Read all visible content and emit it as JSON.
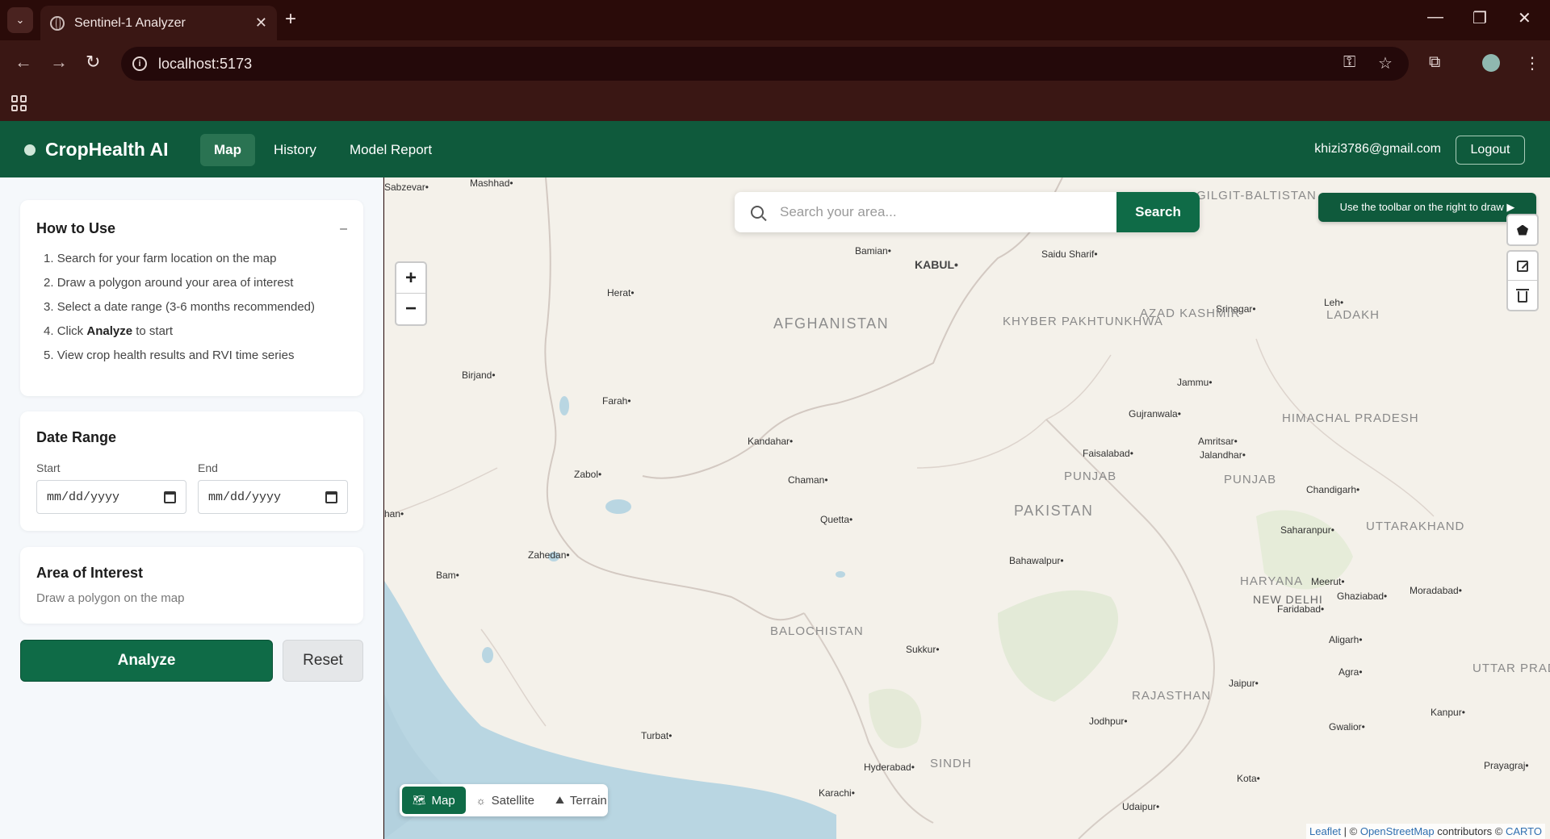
{
  "browser": {
    "tab_title": "Sentinel-1 Analyzer",
    "tab_close": "✕",
    "new_tab": "+",
    "url": "localhost:5173",
    "window_controls": [
      "—",
      "❐",
      "✕"
    ]
  },
  "header": {
    "brand": "CropHealth AI",
    "nav": [
      {
        "label": "Map",
        "active": true
      },
      {
        "label": "History",
        "active": false
      },
      {
        "label": "Model Report",
        "active": false
      }
    ],
    "user_email": "khizi3786@gmail.com",
    "logout_label": "Logout"
  },
  "sidebar": {
    "howto": {
      "title": "How to Use",
      "collapse": "–",
      "steps": [
        {
          "n": "1.",
          "text": "Search for your farm location on the map"
        },
        {
          "n": "2.",
          "text": "Draw a polygon around your area of interest"
        },
        {
          "n": "3.",
          "text": "Select a date range (3-6 months recommended)"
        },
        {
          "n": "4.",
          "pre": "Click ",
          "bold": "Analyze",
          "post": " to start"
        },
        {
          "n": "5.",
          "text": "View crop health results and RVI time series"
        }
      ]
    },
    "date_range": {
      "title": "Date Range",
      "start_label": "Start",
      "end_label": "End",
      "start_value": "mm/dd/yyyy",
      "end_value": "mm/dd/yyyy"
    },
    "aoi": {
      "title": "Area of Interest",
      "hint": "Draw a polygon on the map"
    },
    "analyze_label": "Analyze",
    "reset_label": "Reset"
  },
  "map": {
    "search_placeholder": "Search your area...",
    "search_button": "Search",
    "draw_hint": "Use the toolbar on the right to draw ▶",
    "zoom_in": "+",
    "zoom_out": "−",
    "layers": [
      {
        "label": "Map",
        "icon": "🗺",
        "active": true
      },
      {
        "label": "Satellite",
        "icon": "☼",
        "active": false
      },
      {
        "label": "Terrain",
        "icon": "⛰",
        "active": false
      }
    ],
    "attribution": {
      "leaflet": "Leaflet",
      "sep": " | © ",
      "osm": "OpenStreetMap",
      "rest": " contributors © ",
      "carto": "CARTO"
    },
    "places": [
      "Sabzevar",
      "Mashhad",
      "Bamian",
      "KABUL",
      "Saidu Sharif",
      "Herat",
      "Srinagar",
      "Leh",
      "Birjand",
      "Farah",
      "Jammu",
      "Gujranwala",
      "Kandahar",
      "Amritsar",
      "Faisalabad",
      "Jalandhar",
      "Zabol",
      "Chaman",
      "Chandigarh",
      "Quetta",
      "Saharanpur",
      "Zahedan",
      "Bahawalpur",
      "Bam",
      "Meerut",
      "Ghaziabad",
      "Moradabad",
      "Faridabad",
      "Aligarh",
      "Sukkur",
      "Agra",
      "Jaipur",
      "Kanpur",
      "Jodhpur",
      "Gwalior",
      "Turbat",
      "Hyderabad",
      "Karachi",
      "Kota",
      "Prayagraj",
      "Udaipur",
      "han"
    ],
    "regions": [
      "AFGHANISTAN",
      "KHYBER PAKHTUNKHWA",
      "AZAD KASHMIR",
      "LADAKH",
      "GILGIT-BALTISTAN",
      "HIMACHAL PRADESH",
      "PUNJAB",
      "PUNJAB",
      "PAKISTAN",
      "UTTARAKHAND",
      "HARYANA",
      "NEW DELHI",
      "BALOCHISTAN",
      "RAJASTHAN",
      "UTTAR PRADESH",
      "SINDH"
    ]
  }
}
